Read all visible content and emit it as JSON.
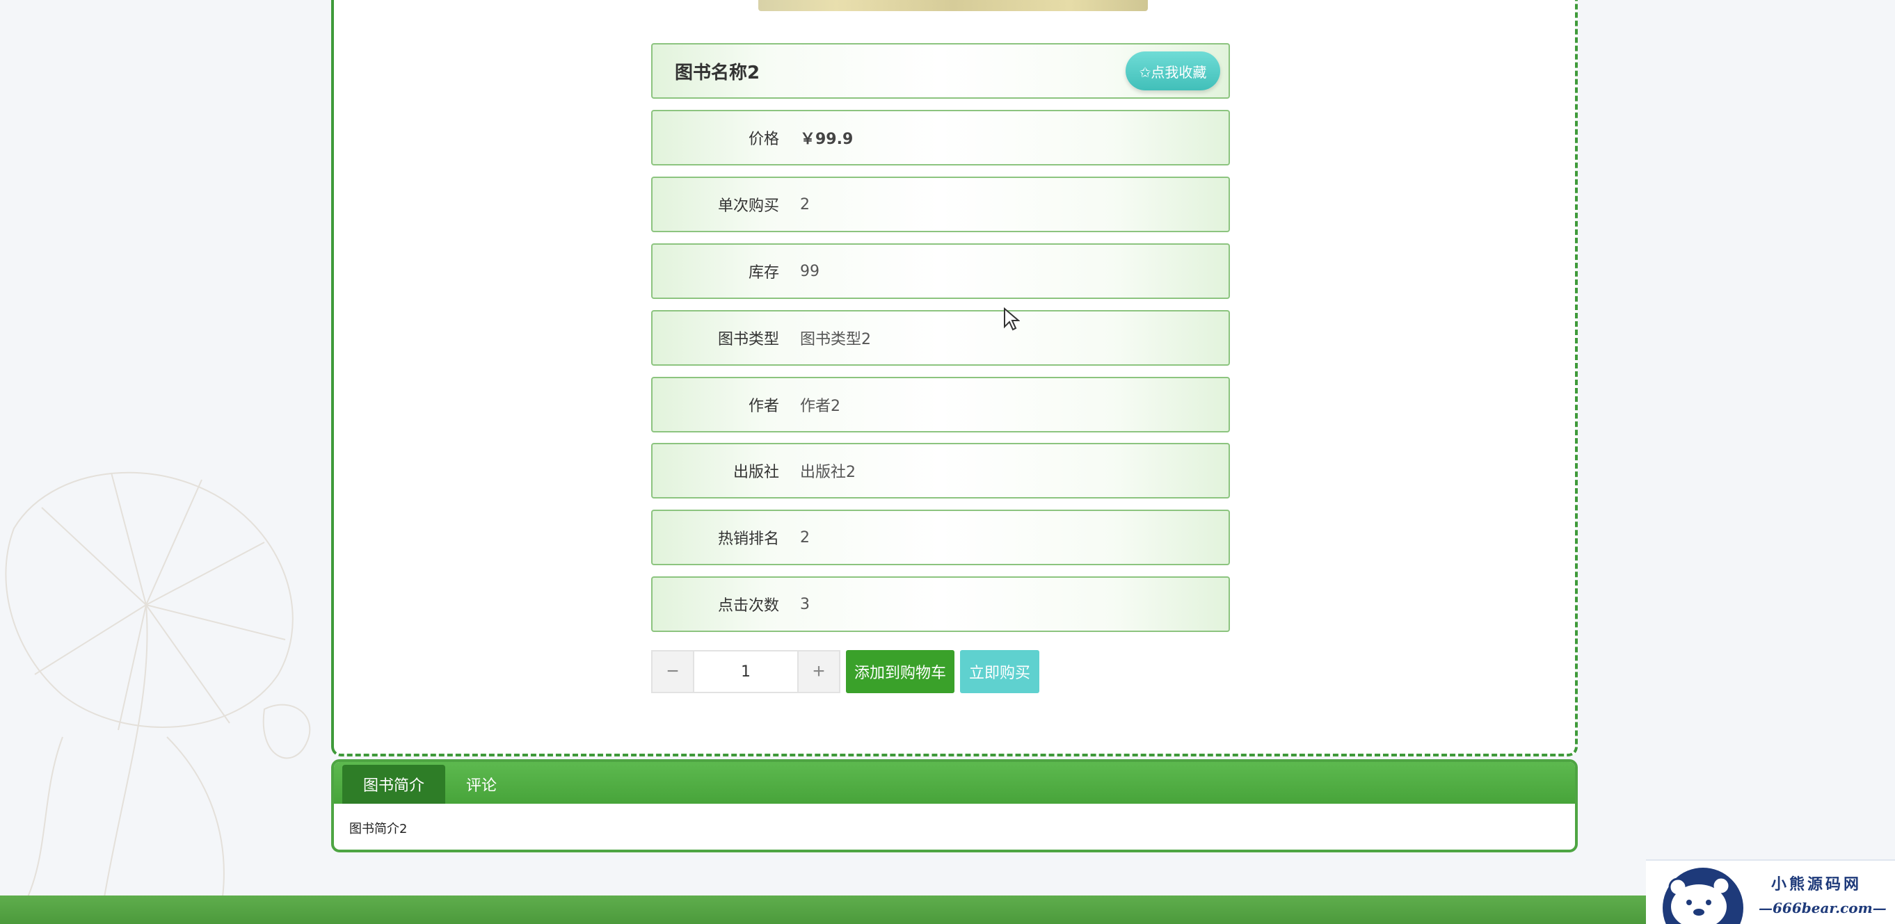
{
  "book": {
    "title": "图书名称2",
    "favorite_label": "✩点我收藏"
  },
  "details": [
    {
      "label": "价格",
      "value": "￥99.9"
    },
    {
      "label": "单次购买",
      "value": "2"
    },
    {
      "label": "库存",
      "value": "99"
    },
    {
      "label": "图书类型",
      "value": "图书类型2"
    },
    {
      "label": "作者",
      "value": "作者2"
    },
    {
      "label": "出版社",
      "value": "出版社2"
    },
    {
      "label": "热销排名",
      "value": "2"
    },
    {
      "label": "点击次数",
      "value": "3"
    }
  ],
  "purchase": {
    "minus": "−",
    "quantity": "1",
    "plus": "+",
    "add_to_cart": "添加到购物车",
    "buy_now": "立即购买"
  },
  "tabs": [
    {
      "label": "图书简介",
      "active": true
    },
    {
      "label": "评论",
      "active": false
    }
  ],
  "tab_content": "图书简介2",
  "watermark": {
    "name": "小熊源码网",
    "site": "—666bear.com—"
  },
  "colors": {
    "accent_green": "#3aa12a",
    "teal": "#5fd1cf",
    "border_green": "#3f9a3a"
  }
}
